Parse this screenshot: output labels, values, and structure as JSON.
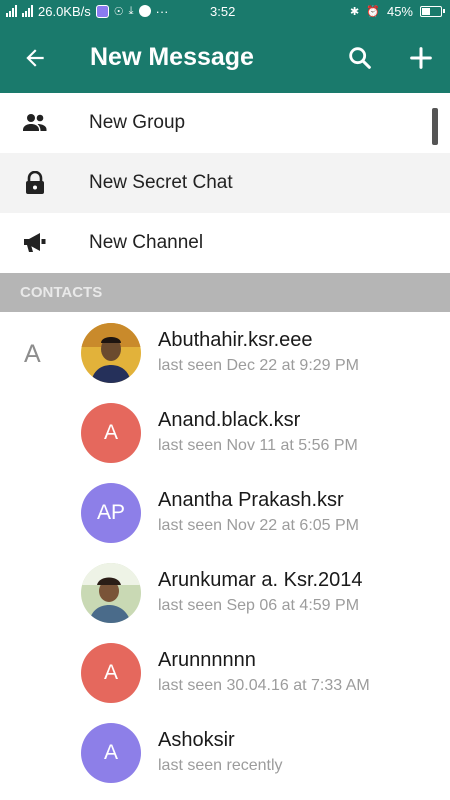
{
  "status_bar": {
    "network_speed": "26.0KB/s",
    "more": "···",
    "time": "3:52",
    "battery": "45%"
  },
  "app_bar": {
    "title": "New Message"
  },
  "menu": [
    {
      "label": "New Group",
      "icon": "group-icon"
    },
    {
      "label": "New Secret Chat",
      "icon": "lock-icon"
    },
    {
      "label": "New Channel",
      "icon": "megaphone-icon"
    }
  ],
  "contacts_header": "CONTACTS",
  "section_letter": "A",
  "contacts": [
    {
      "name": "Abuthahir.ksr.eee",
      "status": "last seen Dec 22 at 9:29 PM",
      "avatar_text": "",
      "avatar_type": "photo",
      "avatar_color": "#6b4a2e"
    },
    {
      "name": "Anand.black.ksr",
      "status": "last seen Nov 11 at 5:56 PM",
      "avatar_text": "A",
      "avatar_type": "initials",
      "avatar_color": "#e5685d"
    },
    {
      "name": "Anantha Prakash.ksr",
      "status": "last seen Nov 22 at 6:05 PM",
      "avatar_text": "AP",
      "avatar_type": "initials",
      "avatar_color": "#8d7fe8"
    },
    {
      "name": "Arunkumar a. Ksr.2014",
      "status": "last seen Sep 06 at 4:59 PM",
      "avatar_text": "",
      "avatar_type": "photo",
      "avatar_color": "#7f9a6a"
    },
    {
      "name": "Arunnnnnn",
      "status": "last seen 30.04.16 at 7:33 AM",
      "avatar_text": "A",
      "avatar_type": "initials",
      "avatar_color": "#e5685d"
    },
    {
      "name": "Ashoksir",
      "status": "last seen recently",
      "avatar_text": "A",
      "avatar_type": "initials",
      "avatar_color": "#8d7fe8"
    }
  ],
  "colors": {
    "primary": "#1a7a6c",
    "section_header_bg": "#b5b5b5",
    "secondary_text": "#9c9c9c"
  }
}
